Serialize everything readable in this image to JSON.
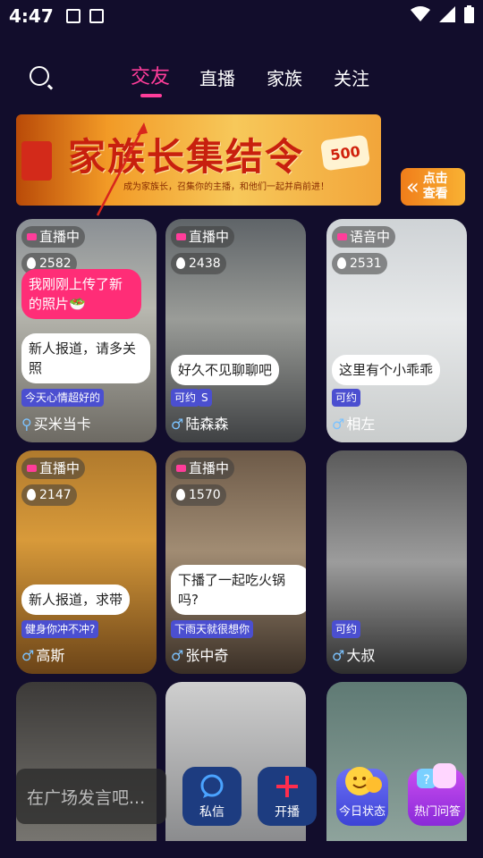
{
  "status_bar": {
    "time": "4:47"
  },
  "tabs": [
    "交友",
    "直播",
    "家族",
    "关注"
  ],
  "banner": {
    "title": "家族长集结令",
    "subtitle": "成为家族长，召集你的主播，和他们一起并肩前进！",
    "badge": "500"
  },
  "click_button": {
    "chevron": "«",
    "label_line1": "点击",
    "label_line2": "查看"
  },
  "cards": [
    {
      "badge": "直播中",
      "hot": "2582",
      "bubble_pink": "我刚刚上传了新的照片🥗",
      "bubble": "新人报道，请多关照",
      "tags": [
        "今天心情超好的"
      ],
      "sex": "⚲",
      "name": "买米当卡"
    },
    {
      "badge": "直播中",
      "hot": "2438",
      "bubble": "好久不见聊聊吧",
      "tags": [
        "可约",
        "S"
      ],
      "sex": "♂",
      "name": "陆森森"
    },
    {
      "badge": "语音中",
      "hot": "2531",
      "bubble": "这里有个小乖乖",
      "tags": [
        "可约"
      ],
      "sex": "♂",
      "name": "相左"
    },
    {
      "badge": "直播中",
      "hot": "2147",
      "bubble": "新人报道，求带",
      "tags": [
        "健身你冲不冲?"
      ],
      "sex": "♂",
      "name": "高斯"
    },
    {
      "badge": "直播中",
      "hot": "1570",
      "bubble": "下播了一起吃火锅吗?",
      "tags": [
        "下雨天就很想你"
      ],
      "sex": "♂",
      "name": "张中奇"
    },
    {
      "tags": [
        "可约"
      ],
      "sex": "♂",
      "name": "大叔"
    }
  ],
  "bottom": {
    "chat_placeholder": "在广场发言吧...",
    "message_label": "私信",
    "live_label": "开播",
    "status_label": "今日状态",
    "qa_label": "热门问答"
  },
  "colors": {
    "accent": "#ff3d9a",
    "background": "#120d2c",
    "tag": "#4b4fd0"
  }
}
